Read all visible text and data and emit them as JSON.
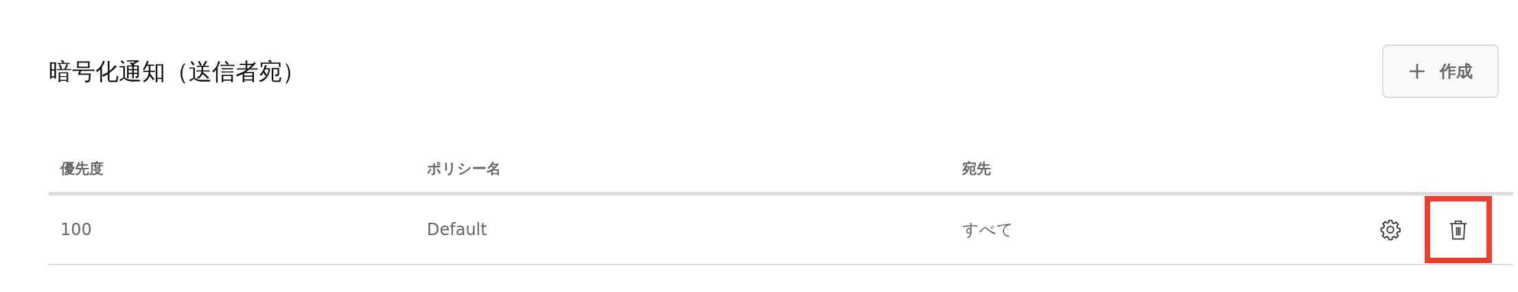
{
  "title": "暗号化通知（送信者宛）",
  "create_button": {
    "label": "作成"
  },
  "table": {
    "columns": [
      "優先度",
      "ポリシー名",
      "宛先"
    ],
    "rows": [
      {
        "cells": [
          "100",
          "Default",
          "すべて"
        ],
        "actions": [
          {
            "kind": "settings",
            "highlighted": false
          },
          {
            "kind": "delete",
            "highlighted": true
          }
        ]
      }
    ]
  }
}
